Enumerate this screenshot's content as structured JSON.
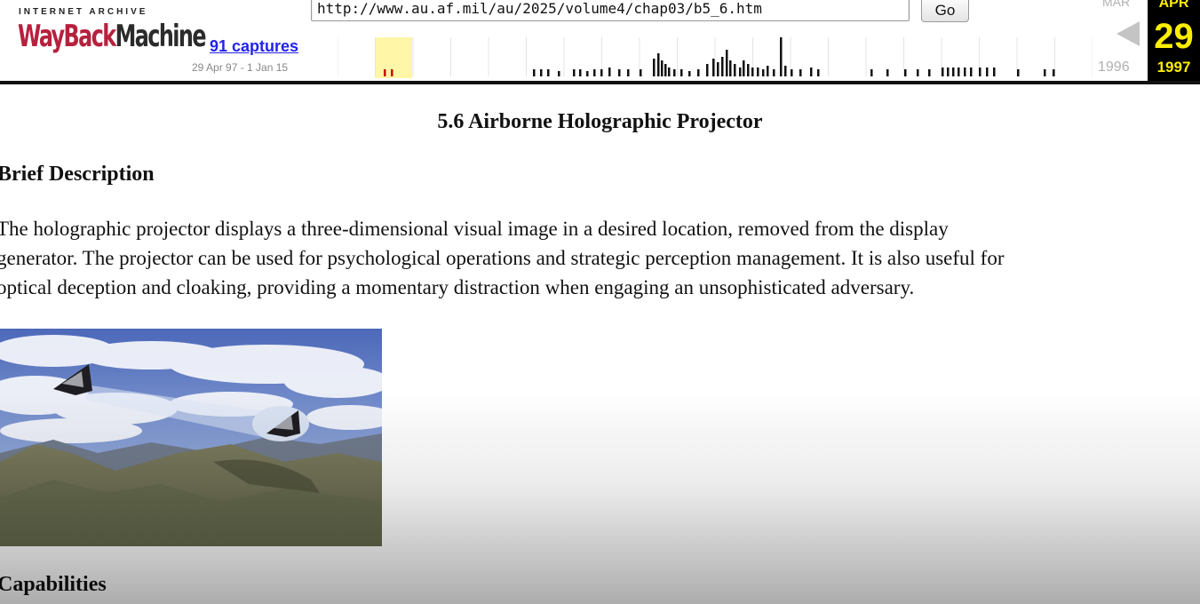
{
  "wayback": {
    "logo_top": "INTERNET ARCHIVE",
    "logo_wayback": "WayBack",
    "logo_machine": "Machine",
    "url": "http://www.au.af.mil/au/2025/volume4/chap03/b5_6.htm",
    "go_label": "Go",
    "captures_label": "91 captures",
    "capture_range": "29 Apr 97 - 1 Jan 15",
    "prev_month": "MAR",
    "prev_year": "1996",
    "current_month": "APR",
    "current_day": "29",
    "current_year": "1997",
    "accent_color": "#ffee00",
    "highlight_color": "#fff6a8"
  },
  "page": {
    "title": "5.6 Airborne Holographic Projector",
    "brief_heading": "Brief Description",
    "description_lines": [
      "The holographic projector displays a three-dimensional visual image in a desired location, removed from the display",
      "generator. The projector can be used for psychological operations and strategic perception management. It is also useful for",
      "optical deception and cloaking, providing a momentary distraction when engaging an unsophisticated adversary."
    ],
    "capabilities_heading": "Capabilities"
  }
}
